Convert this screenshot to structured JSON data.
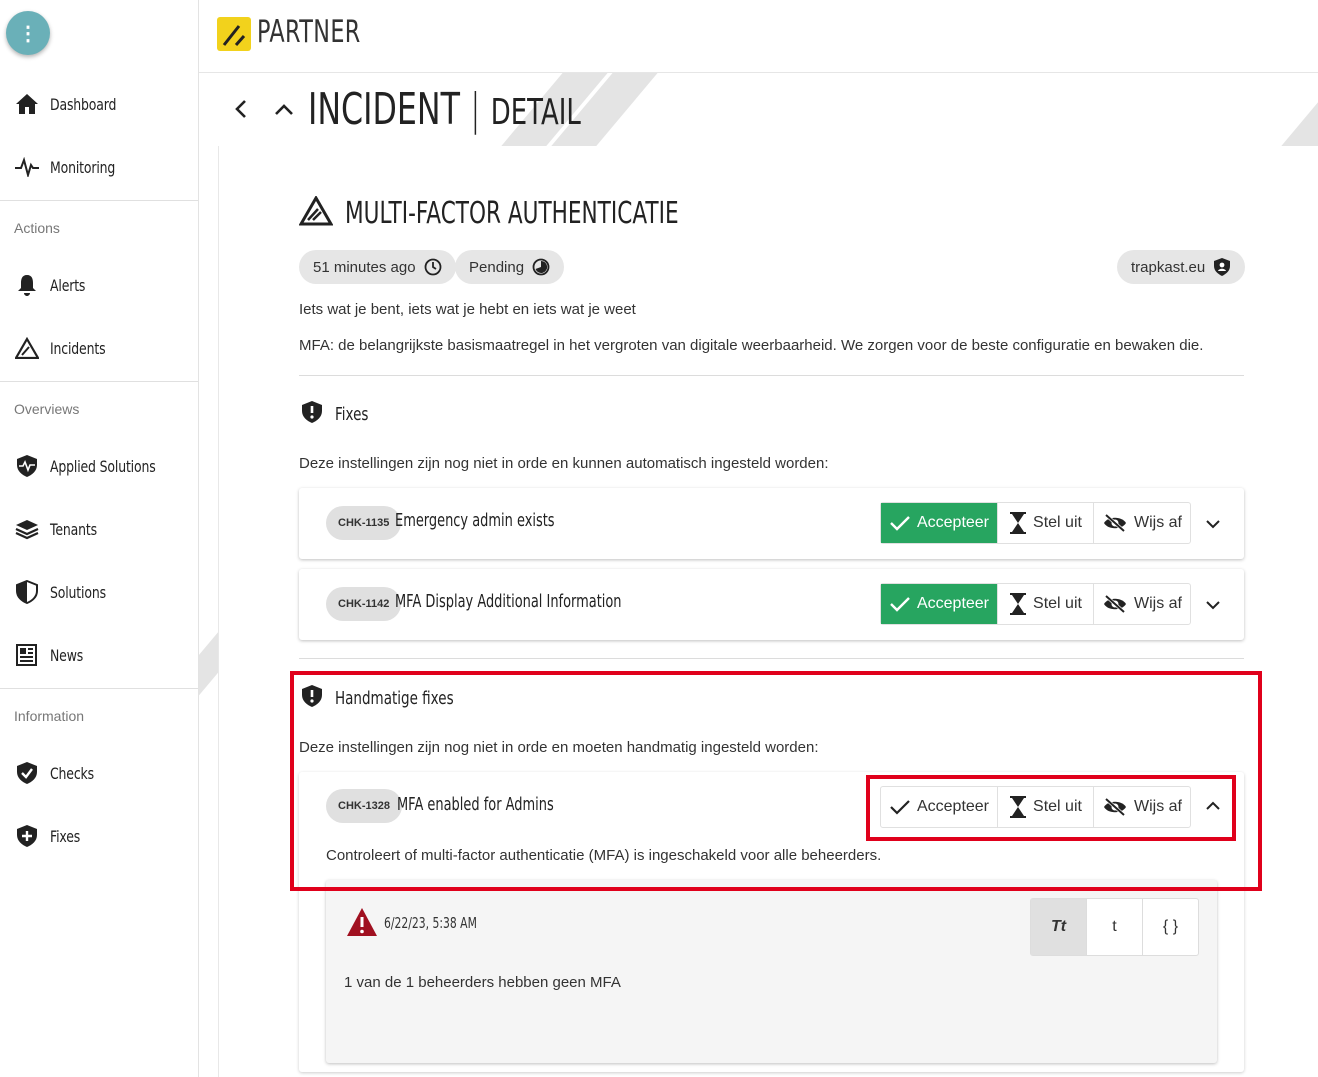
{
  "sidebar": {
    "menu_glyph": "⋮",
    "items_top": [
      {
        "label": "Dashboard",
        "icon": "home-icon"
      },
      {
        "label": "Monitoring",
        "icon": "pulse-icon"
      }
    ],
    "sections": [
      {
        "title": "Actions",
        "items": [
          {
            "label": "Alerts",
            "icon": "bell-icon"
          },
          {
            "label": "Incidents",
            "icon": "incident-icon"
          }
        ]
      },
      {
        "title": "Overviews",
        "items": [
          {
            "label": "Applied Solutions",
            "icon": "shield-pulse-icon"
          },
          {
            "label": "Tenants",
            "icon": "layers-icon"
          },
          {
            "label": "Solutions",
            "icon": "shield-half-icon"
          },
          {
            "label": "News",
            "icon": "newspaper-icon"
          }
        ]
      },
      {
        "title": "Information",
        "items": [
          {
            "label": "Checks",
            "icon": "shield-check-icon"
          },
          {
            "label": "Fixes",
            "icon": "shield-plus-icon"
          }
        ]
      }
    ]
  },
  "header": {
    "logo_text": "PARTNER",
    "brand_color": "#f2d21c"
  },
  "page": {
    "title": "INCIDENT",
    "separator": "|",
    "subtitle": "DETAIL"
  },
  "incident": {
    "title": "MULTI-FACTOR AUTHENTICATIE",
    "time_chip": "51 minutes ago",
    "status_chip": "Pending",
    "tenant_chip": "trapkast.eu",
    "tagline": "Iets wat je bent, iets wat je hebt en iets wat je weet",
    "description": "MFA: de belangrijkste basismaatregel in het vergroten van digitale weerbaarheid. We zorgen voor de beste configuratie en bewaken die."
  },
  "fixes": {
    "title": "Fixes",
    "intro": "Deze instellingen zijn nog niet in orde en kunnen automatisch ingesteld worden:",
    "items": [
      {
        "code": "CHK-1135",
        "title": "Emergency admin exists"
      },
      {
        "code": "CHK-1142",
        "title": "MFA Display Additional Information"
      }
    ]
  },
  "manual_fixes": {
    "title": "Handmatige fixes",
    "intro": "Deze instellingen zijn nog niet in orde en moeten handmatig ingesteld worden:",
    "item": {
      "code": "CHK-1328",
      "title": "MFA enabled for Admins",
      "description": "Controleert of multi-factor authenticatie (MFA) is ingeschakeld voor alle beheerders."
    }
  },
  "actions": {
    "accept": "Accepteer",
    "postpone": "Stel uit",
    "reject": "Wijs af",
    "accept_color": "#27a560"
  },
  "result": {
    "timestamp": "6/22/23, 5:38 AM",
    "message": "1 van de 1 beheerders hebben geen MFA",
    "view_modes": [
      "Tt",
      "t",
      "{ }"
    ],
    "warning_color": "#a01020"
  },
  "highlight_color": "#e0001b"
}
